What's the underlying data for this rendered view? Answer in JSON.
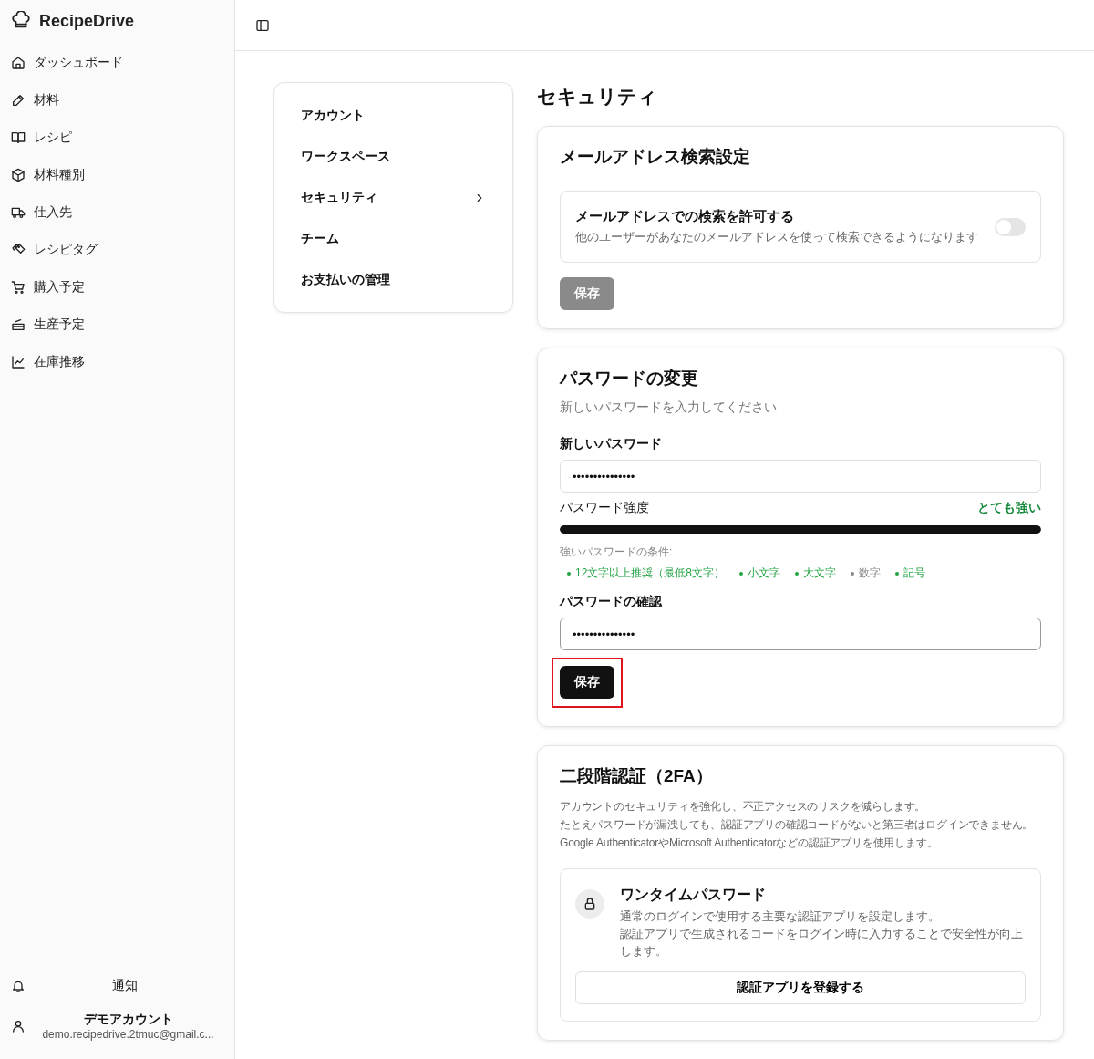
{
  "app": {
    "name": "RecipeDrive"
  },
  "sidebar": {
    "items": [
      {
        "label": "ダッシュボード",
        "kind": "home"
      },
      {
        "label": "材料",
        "kind": "pen"
      },
      {
        "label": "レシピ",
        "kind": "book"
      },
      {
        "label": "材料種別",
        "kind": "box"
      },
      {
        "label": "仕入先",
        "kind": "truck"
      },
      {
        "label": "レシピタグ",
        "kind": "tags"
      },
      {
        "label": "購入予定",
        "kind": "cart"
      },
      {
        "label": "生産予定",
        "kind": "pot"
      },
      {
        "label": "在庫推移",
        "kind": "chart"
      }
    ],
    "notifications": {
      "label": "通知"
    },
    "account": {
      "name": "デモアカウント",
      "email": "demo.recipedrive.2tmuc@gmail.c..."
    }
  },
  "settings_nav": [
    {
      "label": "アカウント",
      "selected": false
    },
    {
      "label": "ワークスペース",
      "selected": false
    },
    {
      "label": "セキュリティ",
      "selected": true
    },
    {
      "label": "チーム",
      "selected": false
    },
    {
      "label": "お支払いの管理",
      "selected": false
    }
  ],
  "page_title": "セキュリティ",
  "email_search": {
    "title": "メールアドレス検索設定",
    "option": {
      "label": "メールアドレスでの検索を許可する",
      "description": "他のユーザーがあなたのメールアドレスを使って検索できるようになります",
      "on": false
    },
    "save_button": {
      "label": "保存",
      "disabled": true,
      "highlighted": false
    }
  },
  "password": {
    "title": "パスワードの変更",
    "subtitle": "新しいパスワードを入力してください",
    "new_label": "新しいパスワード",
    "new_value": "•••••••••••••••",
    "strength_label": "パスワード強度",
    "strength_text": "とても強い",
    "level": 1,
    "requirements_title": "強いパスワードの条件:",
    "requirements": [
      {
        "label": "12文字以上推奨（最低8文字）",
        "met": true
      },
      {
        "label": "小文字",
        "met": true
      },
      {
        "label": "大文字",
        "met": true
      },
      {
        "label": "数字",
        "met": false
      },
      {
        "label": "記号",
        "met": true
      }
    ],
    "confirm_label": "パスワードの確認",
    "confirm_value": "•••••••••••••••",
    "save_button": {
      "label": "保存",
      "disabled": false,
      "highlighted": true
    }
  },
  "two_factor": {
    "title": "二段階認証（2FA）",
    "description": [
      "アカウントのセキュリティを強化し、不正アクセスのリスクを減らします。",
      "たとえパスワードが漏洩しても、認証アプリの確認コードがないと第三者はログインできません。",
      "Google AuthenticatorやMicrosoft Authenticatorなどの認証アプリを使用します。"
    ],
    "method": {
      "title": "ワンタイムパスワード",
      "description": [
        "通常のログインで使用する主要な認証アプリを設定します。",
        "認証アプリで生成されるコードをログイン時に入力することで安全性が向上します。"
      ],
      "button": "認証アプリを登録する"
    }
  }
}
